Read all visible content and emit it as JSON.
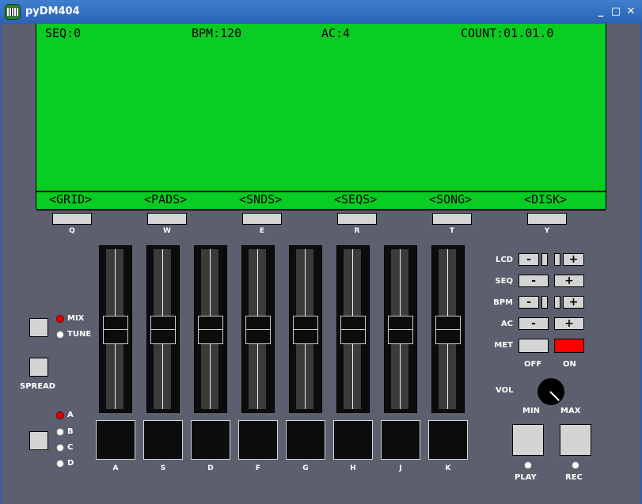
{
  "window": {
    "title": "pyDM404",
    "minimize": "_",
    "maximize": "□",
    "close": "✕",
    "icon": "piano-app-icon"
  },
  "lcd": {
    "status": {
      "seq": "SEQ:0",
      "bpm": "BPM:120",
      "ac": "AC:4",
      "count": "COUNT:01.01.0"
    },
    "menu": [
      "<GRID>",
      "<PADS>",
      "<SNDS>",
      "<SEQS>",
      "<SONG>",
      "<DISK>"
    ],
    "color": "#0acd23"
  },
  "menu_keys": [
    "Q",
    "W",
    "E",
    "R",
    "T",
    "Y"
  ],
  "pad_keys": [
    "A",
    "S",
    "D",
    "F",
    "G",
    "H",
    "J",
    "K"
  ],
  "left_panel": {
    "mix_label": "MIX",
    "tune_label": "TUNE",
    "spread_label": "SPREAD",
    "banks": [
      "A",
      "B",
      "C",
      "D"
    ],
    "selected_bank": "A",
    "selected_mode": "MIX"
  },
  "controls": {
    "lcd": "LCD",
    "seq": "SEQ",
    "bpm": "BPM",
    "ac": "AC",
    "met": "MET",
    "minus": "-",
    "plus": "+",
    "off": "OFF",
    "on": "ON",
    "met_on_color": "#ff0000",
    "vol": "VOL",
    "min": "MIN",
    "max": "MAX",
    "play": "PLAY",
    "rec": "REC"
  }
}
